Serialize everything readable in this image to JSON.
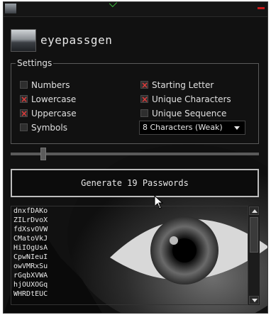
{
  "app": {
    "title": "eyepassgen"
  },
  "settings": {
    "legend": "Settings",
    "options": [
      {
        "label": "Numbers",
        "checked": false
      },
      {
        "label": "Lowercase",
        "checked": true
      },
      {
        "label": "Uppercase",
        "checked": true
      },
      {
        "label": "Symbols",
        "checked": false
      },
      {
        "label": "Starting Letter",
        "checked": true
      },
      {
        "label": "Unique Characters",
        "checked": true
      },
      {
        "label": "Unique Sequence",
        "checked": false
      }
    ],
    "length_select": {
      "value": "8 Characters (Weak)"
    }
  },
  "count_slider": {
    "value": 19
  },
  "generate": {
    "label": "Generate 19 Passwords"
  },
  "passwords": [
    "dnxfDAKo",
    "ZILrDvoX",
    "fdXsvOVW",
    "CMatoVkJ",
    "HiIOgUsA",
    "CpwNIeuI",
    "owVMRxSu",
    "rGqbXVWA",
    "hjOUXOGq",
    "WHRDtEUC"
  ],
  "colors": {
    "accent_red": "#e23b3b",
    "text": "#e6e6e6",
    "bg": "#111111"
  }
}
